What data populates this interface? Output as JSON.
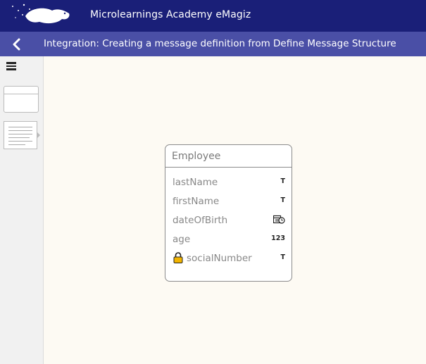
{
  "header": {
    "app_title": "Microlearnings Academy eMagiz"
  },
  "navbar": {
    "title": "Integration: Creating a message definition from Define Message Structure"
  },
  "entity": {
    "name": "Employee",
    "attributes": [
      {
        "name": "lastName",
        "type": "T",
        "type_icon": "text-type-icon",
        "locked": false
      },
      {
        "name": "firstName",
        "type": "T",
        "type_icon": "text-type-icon",
        "locked": false
      },
      {
        "name": "dateOfBirth",
        "type": "",
        "type_icon": "datetime-type-icon",
        "locked": false
      },
      {
        "name": "age",
        "type": "123",
        "type_icon": "number-type-icon",
        "locked": false
      },
      {
        "name": "socialNumber",
        "type": "T",
        "type_icon": "text-type-icon",
        "locked": true
      }
    ]
  },
  "colors": {
    "topbar": "#1a1f78",
    "navbar": "#4a4fa6",
    "canvas": "#fdfaf3",
    "lock": "#f2b400"
  }
}
